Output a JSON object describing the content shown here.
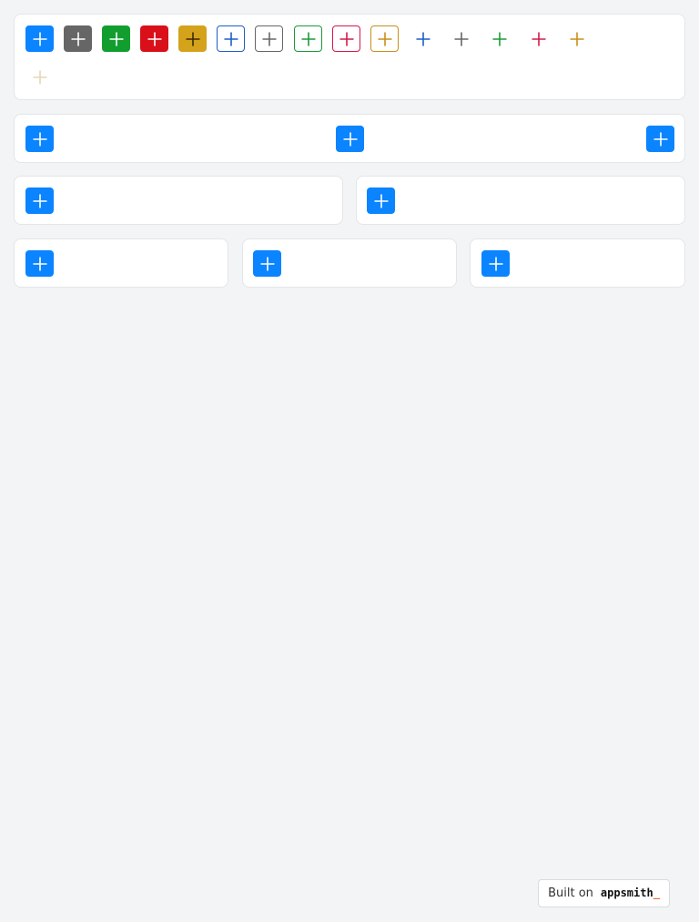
{
  "colors": {
    "blue": "#0a84ff",
    "gray": "#666666",
    "green": "#129e2f",
    "red": "#d9101a",
    "yellow": "#d4a21b",
    "outline_blue": "#1b5fc5",
    "outline_gray": "#666666",
    "outline_green": "#1a9a3a",
    "outline_red": "#d6184a",
    "outline_yellow": "#c98f1a",
    "ghost_tan": "#e4d7b5"
  },
  "icons": {
    "plus": "plus-icon"
  },
  "footer": {
    "built_on": "Built on",
    "brand": "appsmith",
    "brand_cursor": "_"
  }
}
